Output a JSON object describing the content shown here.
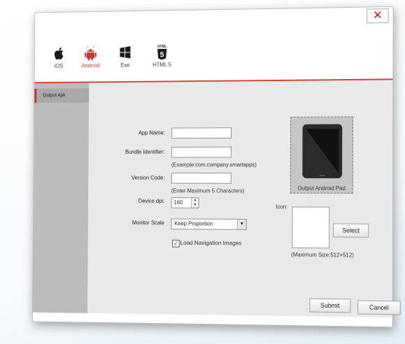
{
  "window": {
    "close_glyph": "✕"
  },
  "platforms": [
    {
      "label": "iOS",
      "icon": "apple-icon",
      "active": false
    },
    {
      "label": "Android",
      "icon": "android-icon",
      "active": true
    },
    {
      "label": "Exe",
      "icon": "windows-icon",
      "active": false
    },
    {
      "label": "HTML 5",
      "icon": "html5-icon",
      "active": false
    }
  ],
  "html5_badge": {
    "top": "HTML",
    "number": "5"
  },
  "sidebar": {
    "items": [
      {
        "label": "Output Apk"
      }
    ]
  },
  "form": {
    "app_name_label": "App Name:",
    "app_name_value": "",
    "bundle_label": "Bundle Identifier:",
    "bundle_value": "",
    "bundle_hint": "(Example:com.company.smartapps)",
    "version_label": "Version Code:",
    "version_value": "",
    "version_hint": "(Enter Maximum 5 Characters)",
    "dpi_label": "Device dpi:",
    "dpi_value": "160",
    "scale_label": "Monitor Scale",
    "scale_value": "Keep Proportion",
    "nav_checkbox_label": "Load Navigation Images",
    "nav_checkbox_checked": true
  },
  "preview": {
    "label": "Output Android Pad"
  },
  "icon_section": {
    "label": "Icon:",
    "select_button": "Select",
    "hint": "(Maximum Size:512×512)"
  },
  "footer": {
    "submit": "Submit",
    "cancel": "Cancel"
  },
  "colors": {
    "accent": "#c7392d",
    "sidebar": "#bcbcbc",
    "content": "#e9e9e9"
  }
}
